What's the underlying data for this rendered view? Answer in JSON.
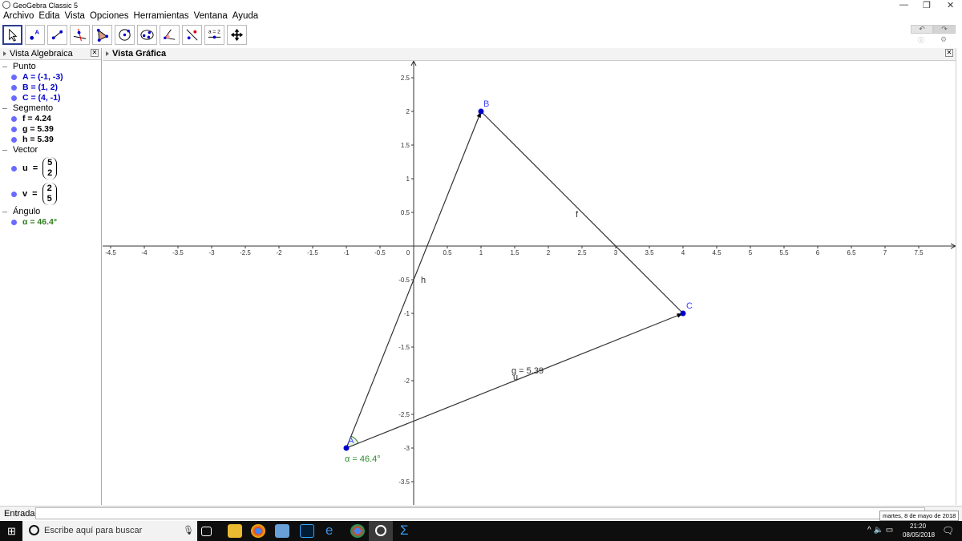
{
  "window": {
    "title": "GeoGebra Classic 5"
  },
  "menu": [
    "Archivo",
    "Edita",
    "Vista",
    "Opciones",
    "Herramientas",
    "Ventana",
    "Ayuda"
  ],
  "tools": [
    "move",
    "point",
    "segment",
    "perpendicular",
    "polygon",
    "circle",
    "conic",
    "angle",
    "reflect",
    "slider",
    "move-graphics"
  ],
  "algebra": {
    "title": "Vista Algebraica",
    "groups": {
      "punto": {
        "label": "Punto",
        "items": [
          "A = (-1, -3)",
          "B = (1, 2)",
          "C = (4, -1)"
        ]
      },
      "segmento": {
        "label": "Segmento",
        "items": [
          "f = 4.24",
          "g = 5.39",
          "h = 5.39"
        ]
      },
      "vector": {
        "label": "Vector",
        "u": {
          "name": "u",
          "eq": "=",
          "x": "5",
          "y": "2"
        },
        "v": {
          "name": "v",
          "eq": "=",
          "x": "2",
          "y": "5"
        }
      },
      "angulo": {
        "label": "Ángulo",
        "items": [
          "α = 46.4°"
        ]
      }
    }
  },
  "graphics": {
    "title": "Vista Gráfica",
    "points": [
      {
        "name": "A",
        "x": -1,
        "y": -3
      },
      {
        "name": "B",
        "x": 1,
        "y": 2
      },
      {
        "name": "C",
        "x": 4,
        "y": -1
      }
    ],
    "labels": {
      "f": "f",
      "h": "h",
      "g": "g = 5.39",
      "u": "u",
      "alpha": "α = 46.4°"
    },
    "xticks": [
      -4.5,
      -4,
      -3.5,
      -3,
      -2.5,
      -2,
      -1.5,
      -1,
      -0.5,
      0,
      0.5,
      1,
      1.5,
      2,
      2.5,
      3,
      3.5,
      4,
      4.5,
      5,
      5.5,
      6,
      6.5,
      7,
      7.5
    ],
    "yticks": [
      -3.5,
      -3,
      -2.5,
      -2,
      -1.5,
      -1,
      -0.5,
      0.5,
      1,
      1.5,
      2,
      2.5
    ],
    "colors": {
      "point": "#0000cc",
      "label": "#4444ff",
      "angle": "#2e8b2e",
      "line": "#333333"
    }
  },
  "entry": {
    "label": "Entrada:",
    "value": ""
  },
  "tooltip": "martes, 8 de mayo de 2018",
  "taskbar": {
    "search_placeholder": "Escribe aquí para buscar",
    "time": "21:20",
    "date": "08/05/2018"
  }
}
